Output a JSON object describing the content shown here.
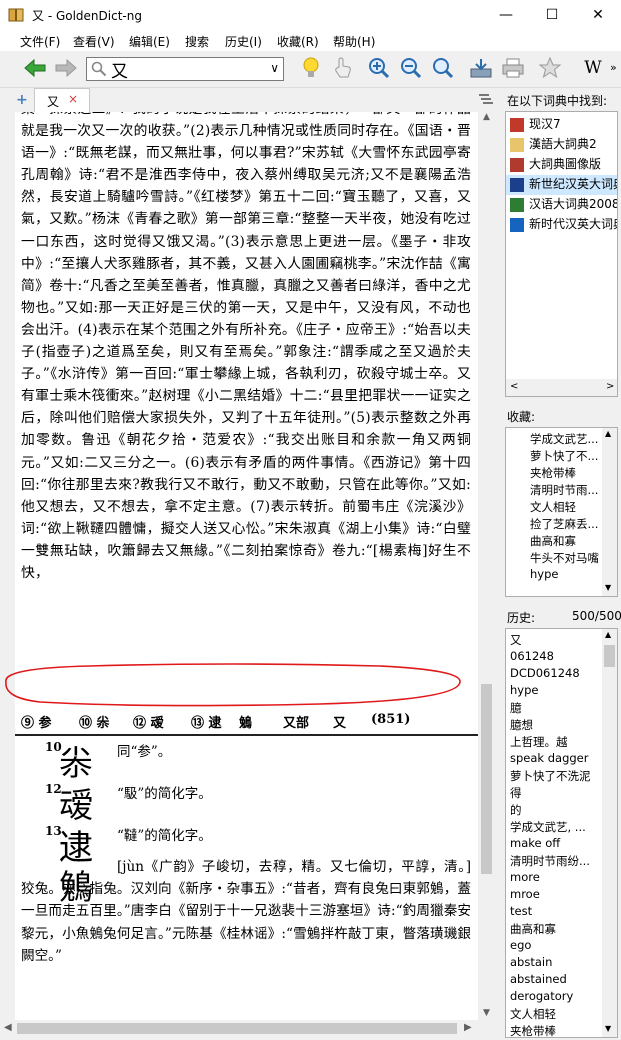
{
  "window": {
    "title": "又 - GoldenDict-ng",
    "controls": [
      "—",
      "☐",
      "✕"
    ]
  },
  "menu": [
    "文件(F)",
    "查看(V)",
    "编辑(E)",
    "搜索",
    "历史(I)",
    "收藏(R)",
    "帮助(H)"
  ],
  "search": {
    "value": "又"
  },
  "toolbar": {
    "wiki_label": "W"
  },
  "tab": {
    "label": "又",
    "close": "×",
    "add": "+"
  },
  "article": {
    "para1": "集・探索之三》:“我的小说是我在生活中探索的结果，一部又一部的作品就是我一次又一次的收获。”(2)表示几种情况或性质同时存在。《国语・晋语一》:“既無老謀，而又無壯事，何以事君?”宋苏轼《大雪怀东武园亭寄孔周翰》诗:“君不是淮西李侍中，夜入蔡州缚取吴元济;又不是襄陽孟浩然，長安道上騎驢吟雪詩。”《红楼梦》第五十二回:“寶玉聽了，又喜，又氣，又歎。”杨沫《青春之歌》第一部第三章:“整整一天半夜，她没有吃过一口东西，这时觉得又饿又渴。”(3)表示意思上更进一层。《墨子・非攻中》:“至攘人犬豕雞豚者，其不義，又甚入人園圃竊桃李。”宋沈作喆《寓简》卷十:“凡香之至美至善者，惟真臘，真臘之又善者曰綠洋，香中之尤物也。”又如:那一天正好是三伏的第一天，又是中午，又没有风，不动也会出汗。(4)表示在某个范围之外有所补充。《庄子・应帝王》:“始吾以夫子(指壺子)之道爲至矣，則又有至焉矣。”郭象注:“謂季咸之至又過於夫子。”《水浒传》第一百回:“軍士攀緣上城，各執利刃，砍殺守城士卒。又有軍士乘木筏衝來。”赵树理《小二黑结婚》十二:“县里把罪状一一证实之后，除叫他们赔偿大家损失外，又判了十五年徒刑。”(5)表示整数之外再加零数。鲁迅《朝花夕拾・范爱农》:“我交出账目和余款一角又两铜元。”又如:二又三分之一。(6)表示有矛盾的两件事情。《西游记》第十四回:“你往那里去來?教我行又不敢行，動又不敢動，只管在此等你。”又如:他又想去，又不想去，拿不定主意。(7)表示转折。前蜀韦庄《浣溪沙》词:“欲上鞦韆四體慵，擬交人送又心忪。”宋朱淑真《湖上小集》诗:“白璧一雙無玷缺，吹簫歸去又無緣。”《二刻拍案惊奇》卷九:“[楊素梅]好生不快，",
    "scan_header": [
      "⑨ 参",
      "⑩ 尜",
      "⑫ 叆",
      "⑬ 逮",
      "鵵",
      "又部",
      "又",
      "(851)"
    ],
    "entries": [
      {
        "num": "10",
        "char": "尜",
        "text": "同“参”。"
      },
      {
        "num": "12",
        "char": "叆",
        "text": "“馺”的简化字。"
      },
      {
        "num": "13",
        "char": "逮",
        "text": "“韃”的简化字。"
      }
    ],
    "entry4_char": "鵵",
    "para2": "[jùn《广韵》子峻切，去稕，精。又七倫切，平諄，清。] 狡兔。亦泛指兔。汉刘向《新序・杂事五》:“昔者，齊有良兔曰東郭鵵，蓋一旦而走五百里。”唐李白《留别于十一兄逖裴十三游塞垣》诗:“釣周獵秦安黎元，小魚鵵兔何足言。”元陈基《桂林谣》:“雪鵵拌杵敲丁東，瞥落璜璣銀闕空。”"
  },
  "dicts_panel": {
    "label": "在以下词典中找到:",
    "items": [
      {
        "name": "现汉7",
        "color": "#c0392b"
      },
      {
        "name": "漢語大詞典2",
        "color": "#e8c46a"
      },
      {
        "name": "大詞典圖像版",
        "color": "#b03a2e"
      },
      {
        "name": "新世纪汉英大词典",
        "color": "#1c3f8c"
      },
      {
        "name": "汉语大词典2008",
        "color": "#2e7d32"
      },
      {
        "name": "新时代汉英大词典",
        "color": "#1565c0"
      }
    ],
    "selected_index": 3
  },
  "favorites_panel": {
    "label": "收藏:",
    "items": [
      "学成文武艺...",
      "萝卜快了不...",
      "夹枪带棒",
      "清明时节雨...",
      "文人相轻",
      "捡了芝麻丢...",
      "曲高和寡",
      "牛头不对马嘴",
      "hype"
    ]
  },
  "history_panel": {
    "label": "历史:",
    "count": "500/500",
    "items": [
      "又",
      "061248",
      "DCD061248",
      "hype",
      "臆",
      "臆想",
      "上哲理。越",
      "speak dagger",
      "萝卜快了不洗泥",
      "得",
      "的",
      "学成文武艺, ...",
      "make off",
      "清明时节雨纷...",
      "more",
      "mroe",
      "test",
      "曲高和寡",
      "ego",
      "abstain",
      "abstained",
      "derogatory",
      "文人相轻",
      "夹枪带棒"
    ]
  }
}
